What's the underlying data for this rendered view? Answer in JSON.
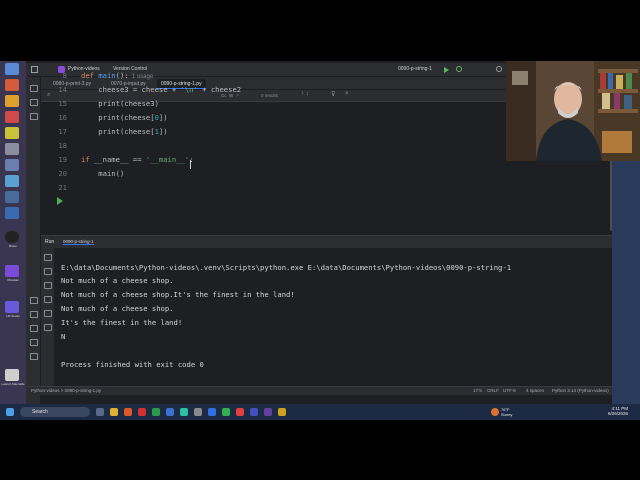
{
  "ide": {
    "project_name": "Python-videos",
    "vcs_label": "Version Control",
    "run_config": "0090-p-string-1",
    "tabs": [
      "0080-p-print-3.py",
      "0070-p-input.py",
      "0090-p-string-1.py"
    ],
    "find_options": "Cc  W  .*",
    "find_results": "0 results"
  },
  "editor": {
    "lines": [
      {
        "num": "8",
        "tokens": [
          {
            "t": "def ",
            "c": "kw"
          },
          {
            "t": "main",
            "c": "fn"
          },
          {
            "t": "():",
            "c": ""
          },
          {
            "t": "  1 usage",
            "c": "hint"
          }
        ]
      },
      {
        "num": "14",
        "tokens": [
          {
            "t": "    cheese3 = cheese + ",
            "c": ""
          },
          {
            "t": "'\\n'",
            "c": "str"
          },
          {
            "t": " + cheese2",
            "c": ""
          }
        ]
      },
      {
        "num": "15",
        "tokens": [
          {
            "t": "    print(cheese3)",
            "c": ""
          }
        ]
      },
      {
        "num": "16",
        "tokens": [
          {
            "t": "    print(cheese[",
            "c": ""
          },
          {
            "t": "0",
            "c": "num"
          },
          {
            "t": "])",
            "c": ""
          }
        ]
      },
      {
        "num": "17",
        "tokens": [
          {
            "t": "    print(cheese[",
            "c": ""
          },
          {
            "t": "1",
            "c": "num"
          },
          {
            "t": "])",
            "c": ""
          }
        ]
      },
      {
        "num": "18",
        "tokens": []
      },
      {
        "num": "19",
        "tokens": [
          {
            "t": "if ",
            "c": "kw"
          },
          {
            "t": "__name__ == ",
            "c": ""
          },
          {
            "t": "'__main__'",
            "c": "str"
          },
          {
            "t": ":",
            "c": ""
          }
        ]
      },
      {
        "num": "20",
        "tokens": [
          {
            "t": "    main()",
            "c": ""
          }
        ]
      },
      {
        "num": "21",
        "tokens": []
      }
    ]
  },
  "run": {
    "label": "Run",
    "tab": "0090-p-string-1",
    "output": [
      "E:\\data\\Documents\\Python-videos\\.venv\\Scripts\\python.exe E:\\data\\Documents\\Python-videos\\0090-p-string-1",
      "Not much of a cheese shop.",
      "Not much of a cheese shop.It's the finest in the land!",
      "Not much of a cheese shop.",
      "It's the finest in the land!",
      "N",
      "",
      "Process finished with exit code 0"
    ]
  },
  "status": {
    "breadcrumb": "Python-videos > 0090-p-string-1.py",
    "position": "17:5",
    "line_sep": "CRLF",
    "encoding": "UTF-8",
    "indent": "4 spaces",
    "interpreter": "Python 3.14 (Python-videos)"
  },
  "taskbar": {
    "search_placeholder": "Search",
    "weather": "76°F Sunny",
    "time": "4:11 PM",
    "date": "6/26/2026"
  },
  "desktop_icons": [
    "Brave",
    "Obsidian",
    "LM Studio",
    "Launch MacroMe"
  ]
}
